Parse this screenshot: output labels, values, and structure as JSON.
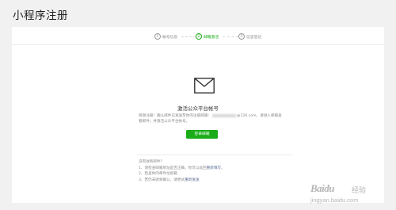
{
  "page": {
    "title": "小程序注册"
  },
  "steps": [
    {
      "num": "1",
      "label": "帐号信息",
      "active": false
    },
    {
      "num": "2",
      "label": "邮箱激活",
      "active": true
    },
    {
      "num": "3",
      "label": "信息登记",
      "active": false
    }
  ],
  "activation": {
    "icon": "envelope-icon",
    "title": "激活公众平台帐号",
    "desc_line1_a": "感谢注册！确认邮件已发送至你的注册邮箱：",
    "desc_line1_b": "@126.com。请进入邮箱查",
    "desc_line2": "看邮件，并激活公众平台帐号。",
    "login_button": "登录邮箱"
  },
  "help": {
    "heading": "没有收到邮件？",
    "item1_text": "1、请检查邮箱地址是否正确，你可以返回",
    "item1_link": "重新填写",
    "item1_end": "。",
    "item2_text": "2、检查你的邮件垃圾箱",
    "item3_text": "3、若仍未收到确认，请尝试",
    "item3_link": "重新发送"
  },
  "watermark": {
    "logo": "Baidu",
    "jingyan": "经验",
    "url": "jingyan.baidu.com"
  },
  "colors": {
    "accent": "#1aad19",
    "link": "#576b95"
  }
}
